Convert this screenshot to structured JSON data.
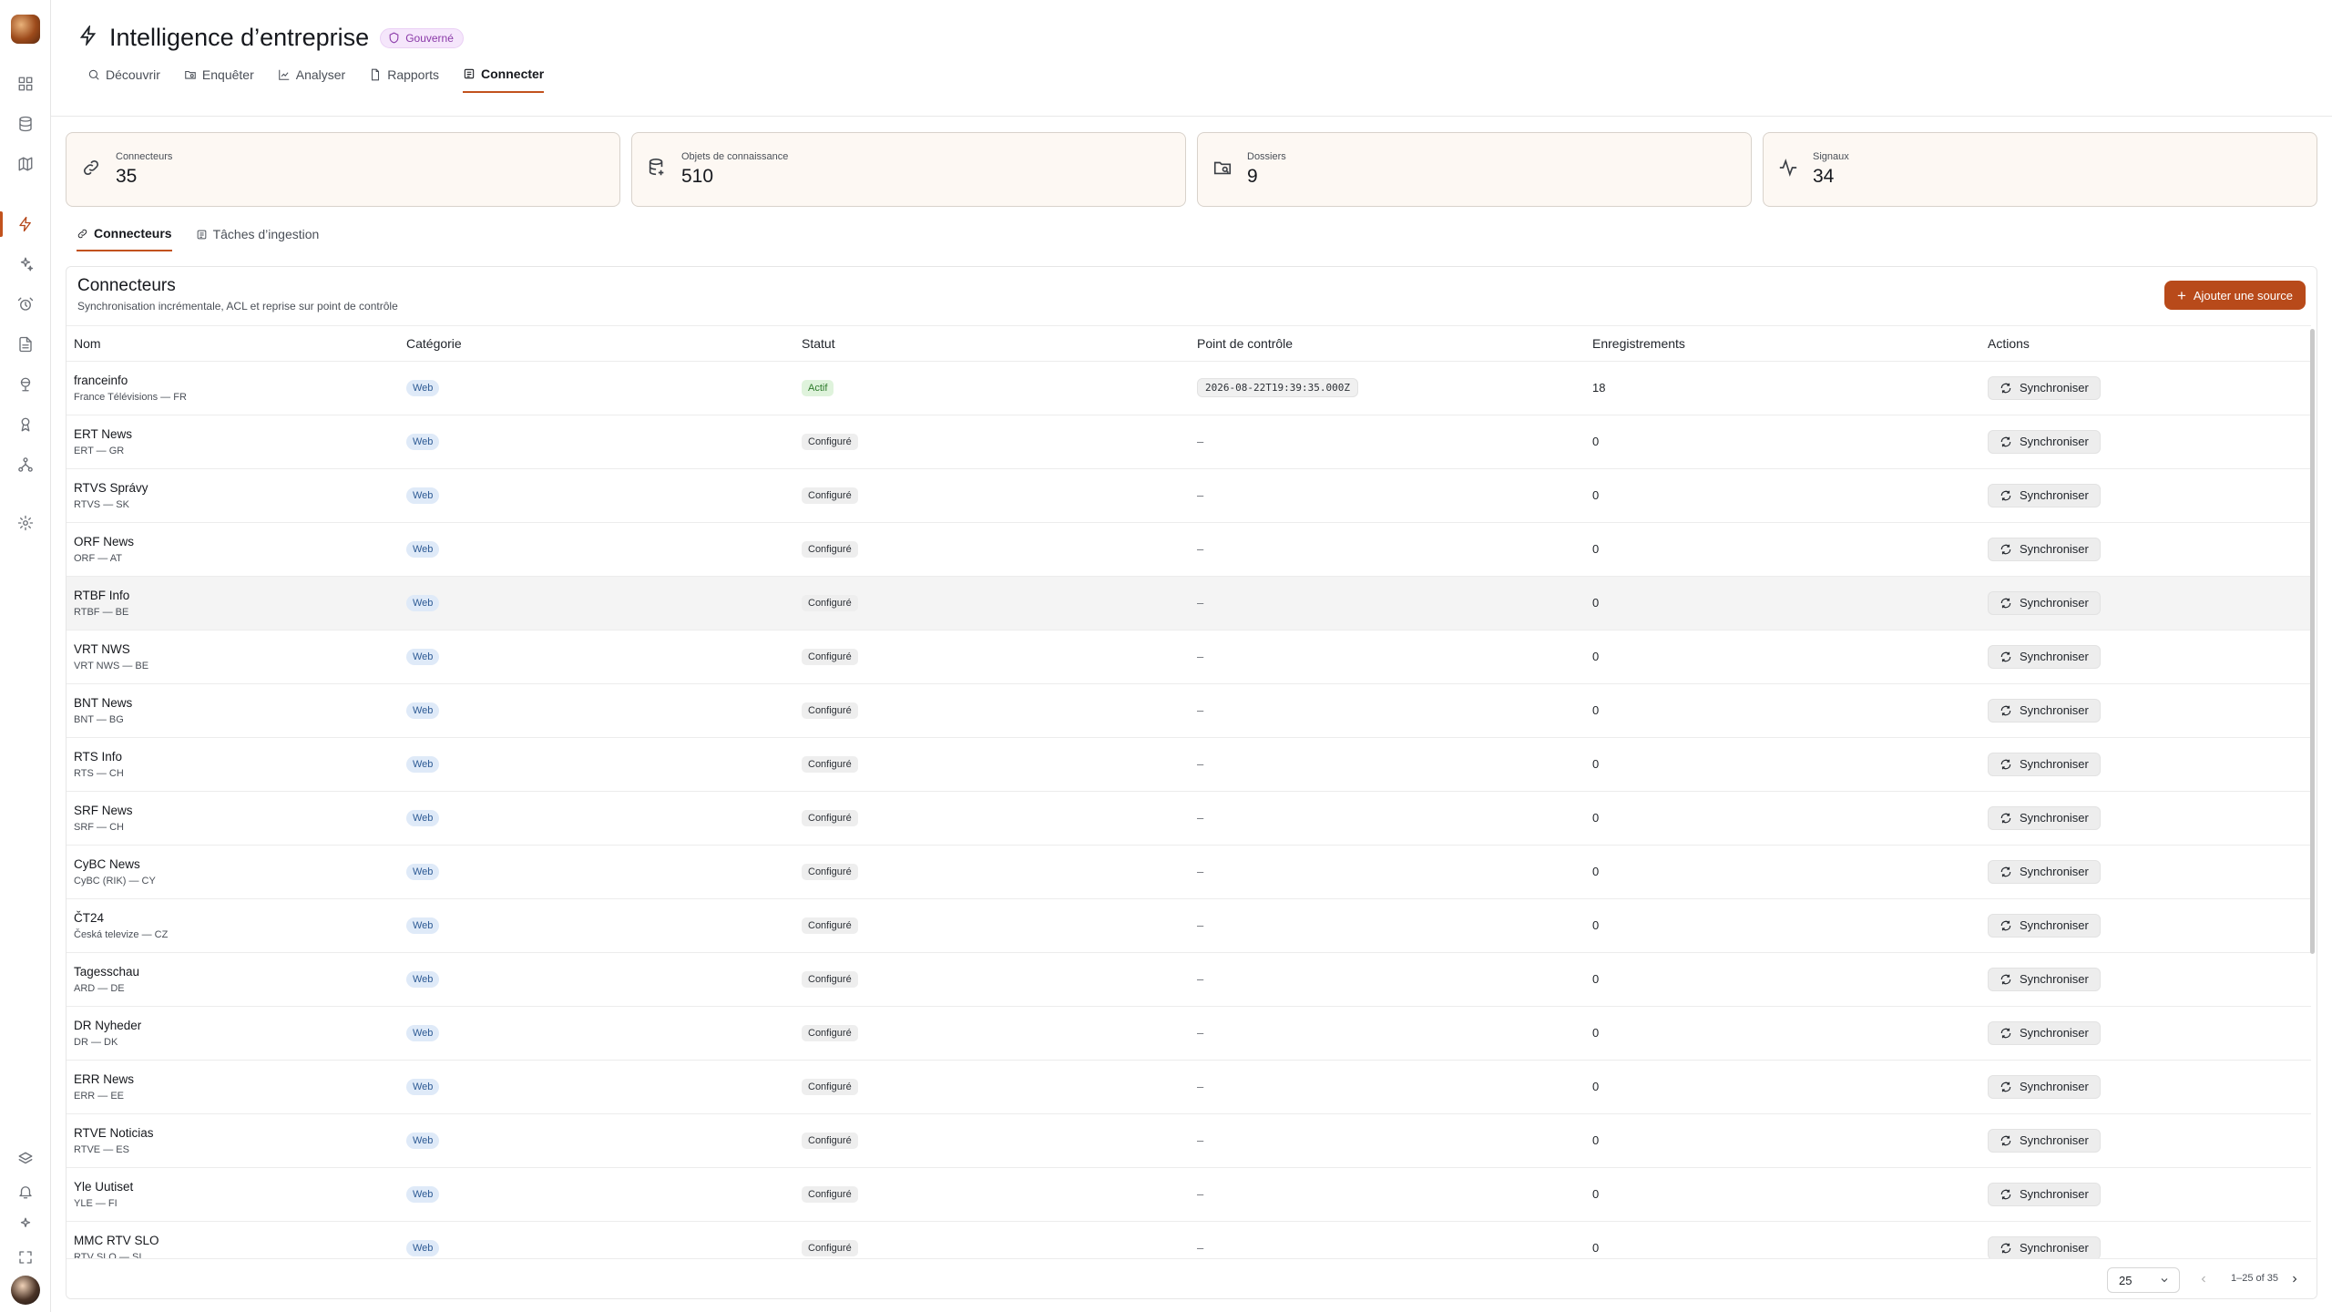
{
  "header": {
    "title": "Intelligence d’entreprise",
    "badge": "Gouverné",
    "nav": [
      {
        "label": "Découvrir"
      },
      {
        "label": "Enquêter"
      },
      {
        "label": "Analyser"
      },
      {
        "label": "Rapports"
      },
      {
        "label": "Connecter"
      }
    ]
  },
  "stats": [
    {
      "label": "Connecteurs",
      "value": "35",
      "icon": "link-icon"
    },
    {
      "label": "Objets de connaissance",
      "value": "510",
      "icon": "database-icon"
    },
    {
      "label": "Dossiers",
      "value": "9",
      "icon": "folder-search-icon"
    },
    {
      "label": "Signaux",
      "value": "34",
      "icon": "activity-icon"
    }
  ],
  "subtabs": [
    {
      "label": "Connecteurs"
    },
    {
      "label": "Tâches d’ingestion"
    }
  ],
  "panel": {
    "title": "Connecteurs",
    "subtitle": "Synchronisation incrémentale, ACL et reprise sur point de contrôle",
    "add_button": "Ajouter une source"
  },
  "table": {
    "columns": [
      "Nom",
      "Catégorie",
      "Statut",
      "Point de contrôle",
      "Enregistrements",
      "Actions"
    ],
    "rows": [
      {
        "name": "franceinfo",
        "sub": "France Télévisions — FR",
        "category": "Web",
        "status": "Actif",
        "checkpoint": "2026-08-22T19:39:35.000Z",
        "records": "18",
        "action": "Synchroniser"
      },
      {
        "name": "ERT News",
        "sub": "ERT — GR",
        "category": "Web",
        "status": "Configuré",
        "checkpoint": "–",
        "records": "0",
        "action": "Synchroniser"
      },
      {
        "name": "RTVS Správy",
        "sub": "RTVS — SK",
        "category": "Web",
        "status": "Configuré",
        "checkpoint": "–",
        "records": "0",
        "action": "Synchroniser"
      },
      {
        "name": "ORF News",
        "sub": "ORF — AT",
        "category": "Web",
        "status": "Configuré",
        "checkpoint": "–",
        "records": "0",
        "action": "Synchroniser"
      },
      {
        "name": "RTBF Info",
        "sub": "RTBF — BE",
        "category": "Web",
        "status": "Configuré",
        "checkpoint": "–",
        "records": "0",
        "action": "Synchroniser"
      },
      {
        "name": "VRT NWS",
        "sub": "VRT NWS — BE",
        "category": "Web",
        "status": "Configuré",
        "checkpoint": "–",
        "records": "0",
        "action": "Synchroniser"
      },
      {
        "name": "BNT News",
        "sub": "BNT — BG",
        "category": "Web",
        "status": "Configuré",
        "checkpoint": "–",
        "records": "0",
        "action": "Synchroniser"
      },
      {
        "name": "RTS Info",
        "sub": "RTS — CH",
        "category": "Web",
        "status": "Configuré",
        "checkpoint": "–",
        "records": "0",
        "action": "Synchroniser"
      },
      {
        "name": "SRF News",
        "sub": "SRF — CH",
        "category": "Web",
        "status": "Configuré",
        "checkpoint": "–",
        "records": "0",
        "action": "Synchroniser"
      },
      {
        "name": "CyBC News",
        "sub": "CyBC (RIK) — CY",
        "category": "Web",
        "status": "Configuré",
        "checkpoint": "–",
        "records": "0",
        "action": "Synchroniser"
      },
      {
        "name": "ČT24",
        "sub": "Česká televize — CZ",
        "category": "Web",
        "status": "Configuré",
        "checkpoint": "–",
        "records": "0",
        "action": "Synchroniser"
      },
      {
        "name": "Tagesschau",
        "sub": "ARD — DE",
        "category": "Web",
        "status": "Configuré",
        "checkpoint": "–",
        "records": "0",
        "action": "Synchroniser"
      },
      {
        "name": "DR Nyheder",
        "sub": "DR — DK",
        "category": "Web",
        "status": "Configuré",
        "checkpoint": "–",
        "records": "0",
        "action": "Synchroniser"
      },
      {
        "name": "ERR News",
        "sub": "ERR — EE",
        "category": "Web",
        "status": "Configuré",
        "checkpoint": "–",
        "records": "0",
        "action": "Synchroniser"
      },
      {
        "name": "RTVE Noticias",
        "sub": "RTVE — ES",
        "category": "Web",
        "status": "Configuré",
        "checkpoint": "–",
        "records": "0",
        "action": "Synchroniser"
      },
      {
        "name": "Yle Uutiset",
        "sub": "YLE — FI",
        "category": "Web",
        "status": "Configuré",
        "checkpoint": "–",
        "records": "0",
        "action": "Synchroniser"
      },
      {
        "name": "MMC RTV SLO",
        "sub": "RTV SLO — SI",
        "category": "Web",
        "status": "Configuré",
        "checkpoint": "–",
        "records": "0",
        "action": "Synchroniser"
      }
    ]
  },
  "pager": {
    "page_size": "25",
    "range": "1–25 of 35"
  },
  "colors": {
    "accent": "#c2521d",
    "primary_button": "#b84a1a",
    "web_pill": "#dfeaf8",
    "active_pill": "#dff3dc"
  }
}
